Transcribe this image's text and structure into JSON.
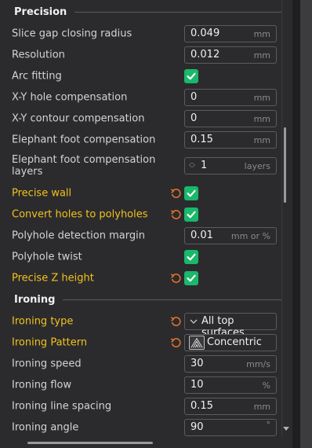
{
  "sections": {
    "precision": {
      "title": "Precision"
    },
    "ironing": {
      "title": "Ironing"
    }
  },
  "rows": {
    "slice_gap": {
      "label": "Slice gap closing radius",
      "value": "0.049",
      "unit": "mm"
    },
    "resolution": {
      "label": "Resolution",
      "value": "0.012",
      "unit": "mm"
    },
    "arc_fitting": {
      "label": "Arc fitting",
      "checked": true
    },
    "xy_hole": {
      "label": "X-Y hole compensation",
      "value": "0",
      "unit": "mm"
    },
    "xy_contour": {
      "label": "X-Y contour compensation",
      "value": "0",
      "unit": "mm"
    },
    "elephant_comp": {
      "label": "Elephant foot compensation",
      "value": "0.15",
      "unit": "mm"
    },
    "elephant_layers": {
      "label": "Elephant foot compensation layers",
      "value": "1",
      "unit": "layers"
    },
    "precise_wall": {
      "label": "Precise wall",
      "checked": true,
      "changed": true
    },
    "convert_holes": {
      "label": "Convert holes to polyholes",
      "checked": true,
      "changed": true
    },
    "polyhole_margin": {
      "label": "Polyhole detection margin",
      "value": "0.01",
      "unit": "mm or %"
    },
    "polyhole_twist": {
      "label": "Polyhole twist",
      "checked": true
    },
    "precise_z": {
      "label": "Precise Z height",
      "checked": true,
      "changed": true
    },
    "ironing_type": {
      "label": "Ironing type",
      "value": "All top surfaces",
      "changed": true
    },
    "ironing_pattern": {
      "label": "Ironing Pattern",
      "value": "Concentric",
      "changed": true
    },
    "ironing_speed": {
      "label": "Ironing speed",
      "value": "30",
      "unit": "mm/s"
    },
    "ironing_flow": {
      "label": "Ironing flow",
      "value": "10",
      "unit": "%"
    },
    "ironing_spacing": {
      "label": "Ironing line spacing",
      "value": "0.15",
      "unit": "mm"
    },
    "ironing_angle": {
      "label": "Ironing angle",
      "value": "90",
      "unit": "°"
    }
  },
  "icons": {
    "reset": "reset-arrow-icon",
    "check": "check-icon",
    "dropdown": "chevron-down-icon",
    "pattern": "concentric-pattern-icon"
  },
  "colors": {
    "changed_label": "#f2c21a",
    "checkbox": "#19b86a",
    "reset_icon": "#e8742a",
    "background": "#2b2b2e"
  }
}
